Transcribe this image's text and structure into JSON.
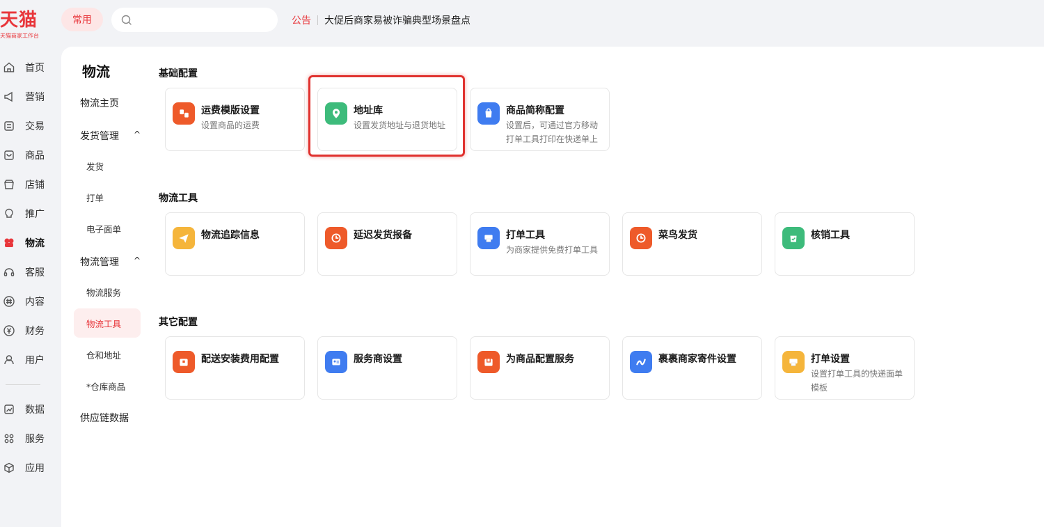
{
  "brand": {
    "logo": "天猫",
    "subtitle": "天猫商家工作台"
  },
  "topbar": {
    "favorites_label": "常用",
    "search_placeholder": "",
    "notice_label": "公告",
    "notice_text": "大促后商家易被诈骗典型场景盘点"
  },
  "mainnav": {
    "items": [
      {
        "label": "首页",
        "icon": "home-icon"
      },
      {
        "label": "营销",
        "icon": "megaphone-icon"
      },
      {
        "label": "交易",
        "icon": "order-icon"
      },
      {
        "label": "商品",
        "icon": "product-icon"
      },
      {
        "label": "店铺",
        "icon": "shop-icon"
      },
      {
        "label": "推广",
        "icon": "bulb-icon"
      },
      {
        "label": "物流",
        "icon": "logistics-icon"
      },
      {
        "label": "客服",
        "icon": "headset-icon"
      },
      {
        "label": "内容",
        "icon": "hashtag-icon"
      },
      {
        "label": "财务",
        "icon": "yuan-icon"
      },
      {
        "label": "用户",
        "icon": "user-icon"
      },
      {
        "label": "数据",
        "icon": "chart-icon"
      },
      {
        "label": "服务",
        "icon": "grid-icon"
      },
      {
        "label": "应用",
        "icon": "cube-icon"
      }
    ]
  },
  "subnav": {
    "title": "物流",
    "home": "物流主页",
    "shipping_group": "发货管理",
    "shipping_items": [
      "发货",
      "打单",
      "电子面单"
    ],
    "logistics_group": "物流管理",
    "logistics_items": [
      "物流服务",
      "物流工具",
      "仓和地址",
      "*仓库商品"
    ],
    "supply_chain": "供应链数据"
  },
  "sections": {
    "basic": {
      "title": "基础配置",
      "cards": [
        {
          "title": "运费模版设置",
          "desc": "设置商品的运费",
          "color": "#ee5a2a",
          "icon": "freight-template-icon"
        },
        {
          "title": "地址库",
          "desc": "设置发货地址与退货地址",
          "color": "#3dbb7b",
          "icon": "location-pin-icon"
        },
        {
          "title": "商品简称配置",
          "desc": "设置后，可通过官方移动打单工具打印在快递单上",
          "color": "#3f7cf0",
          "icon": "shopping-bag-icon"
        }
      ]
    },
    "tools": {
      "title": "物流工具",
      "cards": [
        {
          "title": "物流追踪信息",
          "desc": "",
          "color": "#f5b53b",
          "icon": "paper-plane-icon"
        },
        {
          "title": "延迟发货报备",
          "desc": "",
          "color": "#ee5a2a",
          "icon": "clock-icon"
        },
        {
          "title": "打单工具",
          "desc": "为商家提供免费打单工具",
          "color": "#3f7cf0",
          "icon": "printer-icon"
        },
        {
          "title": "菜鸟发货",
          "desc": "",
          "color": "#ee5a2a",
          "icon": "clock-icon"
        },
        {
          "title": "核销工具",
          "desc": "",
          "color": "#3dbb7b",
          "icon": "verify-bag-icon"
        }
      ]
    },
    "other": {
      "title": "其它配置",
      "cards": [
        {
          "title": "配送安装费用配置",
          "desc": "",
          "color": "#ee5a2a",
          "icon": "install-box-icon"
        },
        {
          "title": "服务商设置",
          "desc": "",
          "color": "#3f7cf0",
          "icon": "provider-card-icon"
        },
        {
          "title": "为商品配置服务",
          "desc": "",
          "color": "#ee5a2a",
          "icon": "service-box-icon"
        },
        {
          "title": "裹裹商家寄件设置",
          "desc": "",
          "color": "#3f7cf0",
          "icon": "guoguo-icon"
        },
        {
          "title": "打单设置",
          "desc": "设置打单工具的快递面单模板",
          "color": "#f5b53b",
          "icon": "printer-icon"
        }
      ]
    }
  }
}
